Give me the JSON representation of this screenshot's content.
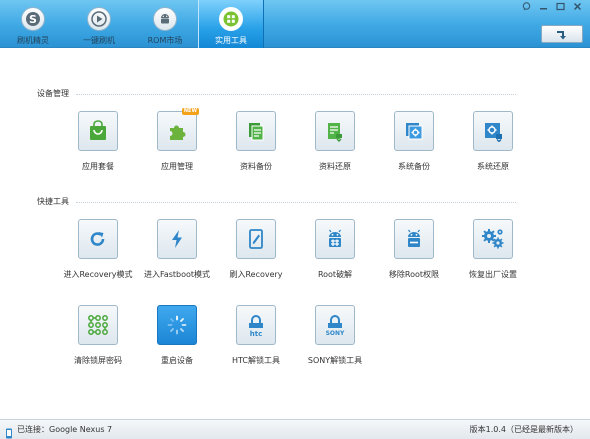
{
  "tabs": [
    {
      "label": "刷机精灵",
      "icon": "s-logo-icon"
    },
    {
      "label": "一键刷机",
      "icon": "play-icon"
    },
    {
      "label": "ROM市场",
      "icon": "android-icon"
    },
    {
      "label": "实用工具",
      "icon": "grid-icon",
      "active": true
    }
  ],
  "window_controls": [
    "feedback-icon",
    "minimize-icon",
    "maximize-icon",
    "close-icon"
  ],
  "sections": {
    "device_management": {
      "title": "设备管理",
      "items": [
        {
          "label": "应用套餐",
          "icon": "shopping-bag-icon"
        },
        {
          "label": "应用管理",
          "icon": "puzzle-icon",
          "badge": "NEW"
        },
        {
          "label": "资料备份",
          "icon": "document-copy-icon"
        },
        {
          "label": "资料还原",
          "icon": "document-restore-icon"
        },
        {
          "label": "系统备份",
          "icon": "system-backup-icon"
        },
        {
          "label": "系统还原",
          "icon": "system-restore-icon"
        }
      ]
    },
    "quick_tools": {
      "title": "快捷工具",
      "items": [
        {
          "label": "进入Recovery模式",
          "icon": "refresh-icon"
        },
        {
          "label": "进入Fastboot模式",
          "icon": "lightning-icon"
        },
        {
          "label": "刷入Recovery",
          "icon": "tablet-edit-icon"
        },
        {
          "label": "Root破解",
          "icon": "android-root-icon"
        },
        {
          "label": "移除Root权限",
          "icon": "android-unroot-icon"
        },
        {
          "label": "恢复出厂设置",
          "icon": "gears-icon"
        },
        {
          "label": "清除锁屏密码",
          "icon": "pattern-lock-icon"
        },
        {
          "label": "重启设备",
          "icon": "reboot-spinner-icon"
        },
        {
          "label": "HTC解锁工具",
          "icon": "htc-lock-icon",
          "brand": "htc"
        },
        {
          "label": "SONY解锁工具",
          "icon": "sony-lock-icon",
          "brand": "SONY"
        }
      ]
    }
  },
  "status": {
    "connection": "已连接：Google Nexus 7",
    "version": "版本1.0.4（已经是最新版本）"
  },
  "colors": {
    "accent": "#1c86d6",
    "icon_blue": "#2f86c8",
    "topbar": "#3ea8e4"
  }
}
